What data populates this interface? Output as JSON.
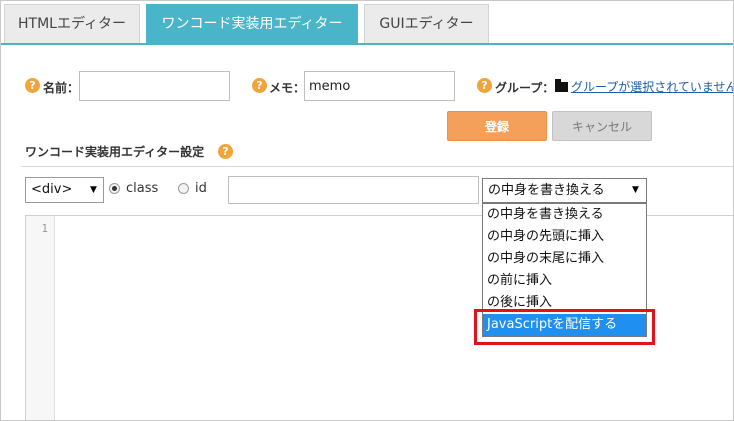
{
  "tabs": [
    {
      "label": "HTMLエディター",
      "active": false
    },
    {
      "label": "ワンコード実装用エディター",
      "active": true
    },
    {
      "label": "GUIエディター",
      "active": false
    }
  ],
  "form": {
    "help_glyph": "?",
    "name_label": "名前：",
    "name_value": "",
    "memo_label": "メモ：",
    "memo_value": "memo",
    "group_label": "グループ：",
    "group_link": "グループが選択されていません"
  },
  "buttons": {
    "register": "登録",
    "cancel": "キャンセル"
  },
  "section": {
    "title": "ワンコード実装用エディター設定"
  },
  "selector": {
    "tag_value": "<div>",
    "radio_class_label": "class",
    "radio_id_label": "id",
    "selected_radio": "class",
    "name_input_value": "",
    "action_value": "の中身を書き換える",
    "caret": "▼"
  },
  "dropdown": {
    "options": [
      "の中身を書き換える",
      "の中身の先頭に挿入",
      "の中身の末尾に挿入",
      "の前に挿入",
      "の後に挿入",
      "JavaScriptを配信する"
    ],
    "highlighted_index": 5
  },
  "editor": {
    "line_numbers": [
      "1"
    ],
    "content": ""
  },
  "colors": {
    "tab_active": "#4ab5c8",
    "accent_orange": "#f4a05b",
    "highlight_red": "#e0131a",
    "dropdown_selected": "#1f8ff0"
  }
}
